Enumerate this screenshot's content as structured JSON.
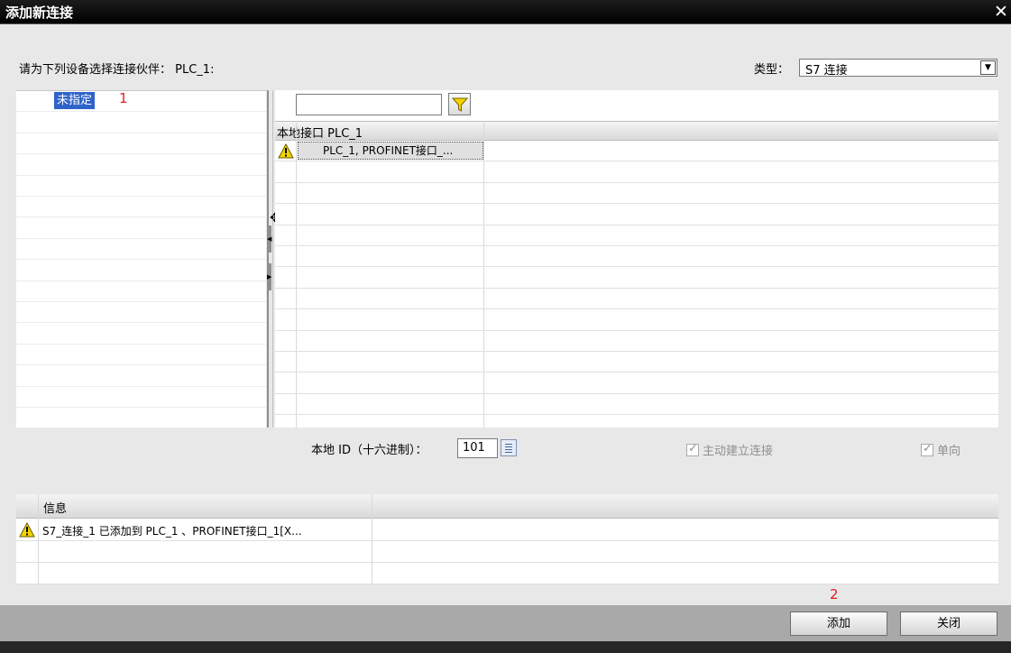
{
  "dialog": {
    "title": "添加新连接",
    "close_glyph": "✕"
  },
  "prompt": "请为下列设备选择连接伙伴： PLC_1:",
  "type": {
    "label": "类型：",
    "value": "S7 连接"
  },
  "tree": {
    "items": [
      {
        "label": "未指定",
        "selected": true
      }
    ]
  },
  "filter": {
    "value": ""
  },
  "grid": {
    "columns": [
      "本地接口 PLC_1"
    ],
    "rows": [
      {
        "status": "warning",
        "interface": "PLC_1, PROFINET接口_..."
      }
    ]
  },
  "local_id": {
    "label": "本地 ID（十六进制）：",
    "value": "101"
  },
  "options": {
    "active_connection": {
      "label": "主动建立连接",
      "checked": true,
      "enabled": false
    },
    "one_way": {
      "label": "单向",
      "checked": true,
      "enabled": false
    }
  },
  "info": {
    "header": "信息",
    "messages": [
      {
        "status": "warning",
        "text": "S7_连接_1 已添加到 PLC_1 、PROFINET接口_1[X..."
      }
    ]
  },
  "buttons": {
    "add": "添加",
    "close": "关闭"
  },
  "annotations": [
    "1",
    "2"
  ],
  "colors": {
    "selection": "#2f63c9",
    "annotation": "#e51c1c",
    "warning": "#f2d400"
  }
}
